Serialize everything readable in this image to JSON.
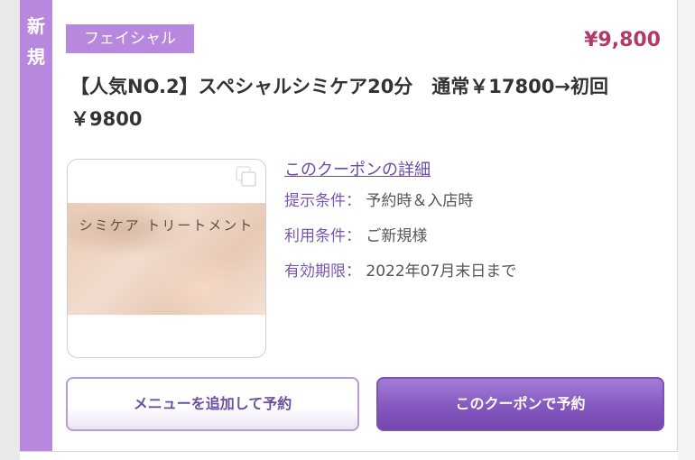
{
  "coupon": {
    "new_badge": "新規",
    "category": "フェイシャル",
    "price": "¥9,800",
    "title": "【人気NO.2】スペシャルシミケア20分　通常￥17800→初回￥9800",
    "image_caption": "シミケア トリートメント",
    "detail_link": "このクーポンの詳細",
    "conditions": [
      {
        "label": "提示条件：",
        "value": "予約時＆入店時"
      },
      {
        "label": "利用条件：",
        "value": "ご新規様"
      },
      {
        "label": "有効期限：",
        "value": "2022年07月末日まで"
      }
    ]
  },
  "buttons": {
    "add_menu": "メニューを追加して予約",
    "book_coupon": "このクーポンで予約"
  },
  "colors": {
    "accent_purple": "#b888de",
    "price_red": "#b03a6c",
    "button_purple": "#8558c0"
  },
  "icons": [
    "copy-icon"
  ]
}
